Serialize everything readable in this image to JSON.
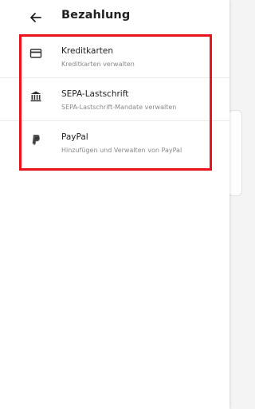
{
  "header": {
    "title": "Bezahlung"
  },
  "payment_methods": [
    {
      "label": "Kreditkarten",
      "sub": "Kreditkarten verwalten",
      "icon": "credit-card-icon"
    },
    {
      "label": "SEPA-Lastschrift",
      "sub": "SEPA-Lastschrift-Mandate verwalten",
      "icon": "bank-icon"
    },
    {
      "label": "PayPal",
      "sub": "Hinzufügen und Verwalten von PayPal",
      "icon": "paypal-icon"
    }
  ],
  "colors": {
    "highlight": "#e8131c",
    "text": "#222222",
    "subtext": "#888888"
  }
}
